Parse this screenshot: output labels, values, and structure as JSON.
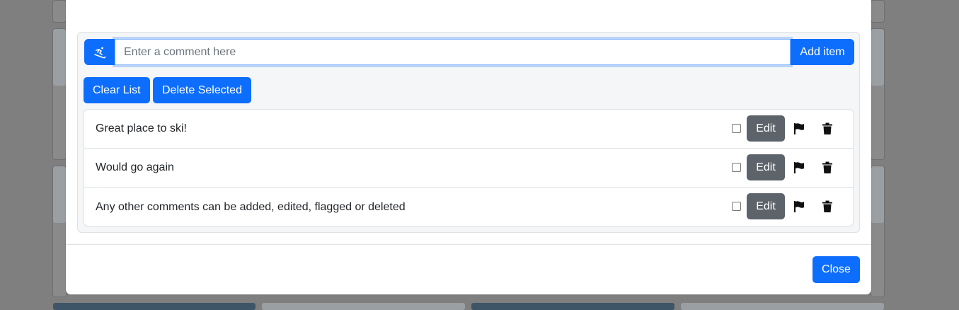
{
  "comment_form": {
    "icon": "skier-icon",
    "placeholder": "Enter a comment here",
    "value": "",
    "add_label": "Add item"
  },
  "actions": {
    "clear_label": "Clear List",
    "delete_selected_label": "Delete Selected"
  },
  "comments": [
    {
      "text": "Great place to ski!",
      "edit_label": "Edit",
      "checked": false
    },
    {
      "text": "Would go again",
      "edit_label": "Edit",
      "checked": false
    },
    {
      "text": "Any other comments can be added, edited, flagged or deleted",
      "edit_label": "Edit",
      "checked": false
    }
  ],
  "footer": {
    "close_label": "Close"
  },
  "colors": {
    "primary": "#0d6efd",
    "secondary": "#5c636a",
    "backdrop": "#7f7f7f"
  }
}
